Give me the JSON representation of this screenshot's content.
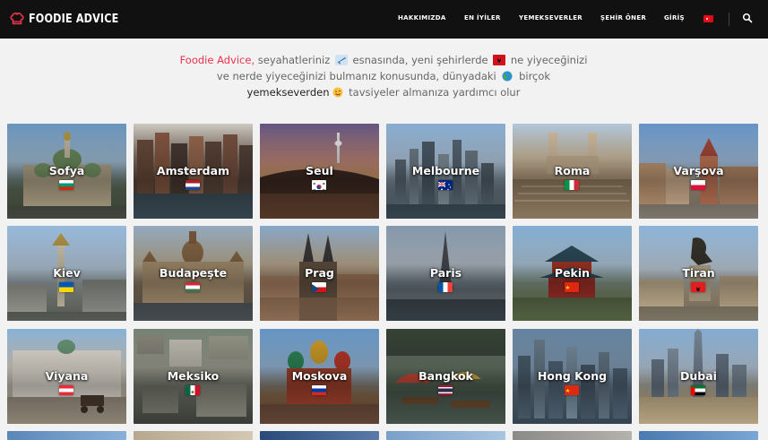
{
  "brand": {
    "name": "FOODIE ADVICE",
    "accent": "#e8334a"
  },
  "nav": {
    "items": [
      {
        "label": "HAKKIMIZDA"
      },
      {
        "label": "EN İYİLER"
      },
      {
        "label": "YEMEKSEVERLER"
      },
      {
        "label": "ŞEHİR ÖNER"
      },
      {
        "label": "GİRİŞ"
      }
    ],
    "language_flag": "flag-turkey-icon",
    "search_icon": "search-icon"
  },
  "intro": {
    "brand": "Foodie Advice,",
    "part1": " seyahatleriniz ",
    "part2": " esnasında, yeni şehirlerde ",
    "part3": " ne yiyeceğinizi ve nerde yiyeceğinizi bulmanız konusunda, dünyadaki ",
    "part4": " birçok ",
    "strong": "yemekseverden",
    "part5": " tavsiyeler almanıza yardımcı olur"
  },
  "cities": [
    {
      "name": "Sofya",
      "flag": "bulgaria"
    },
    {
      "name": "Amsterdam",
      "flag": "netherlands"
    },
    {
      "name": "Seul",
      "flag": "south-korea"
    },
    {
      "name": "Melbourne",
      "flag": "australia"
    },
    {
      "name": "Roma",
      "flag": "italy"
    },
    {
      "name": "Varşova",
      "flag": "poland"
    },
    {
      "name": "Kiev",
      "flag": "ukraine"
    },
    {
      "name": "Budapeşte",
      "flag": "hungary"
    },
    {
      "name": "Prag",
      "flag": "czech-republic"
    },
    {
      "name": "Paris",
      "flag": "france"
    },
    {
      "name": "Pekin",
      "flag": "china"
    },
    {
      "name": "Tiran",
      "flag": "albania"
    },
    {
      "name": "Viyana",
      "flag": "austria"
    },
    {
      "name": "Meksiko",
      "flag": "mexico"
    },
    {
      "name": "Moskova",
      "flag": "russia"
    },
    {
      "name": "Bangkok",
      "flag": "thailand"
    },
    {
      "name": "Hong Kong",
      "flag": "china"
    },
    {
      "name": "Dubai",
      "flag": "uae"
    }
  ]
}
